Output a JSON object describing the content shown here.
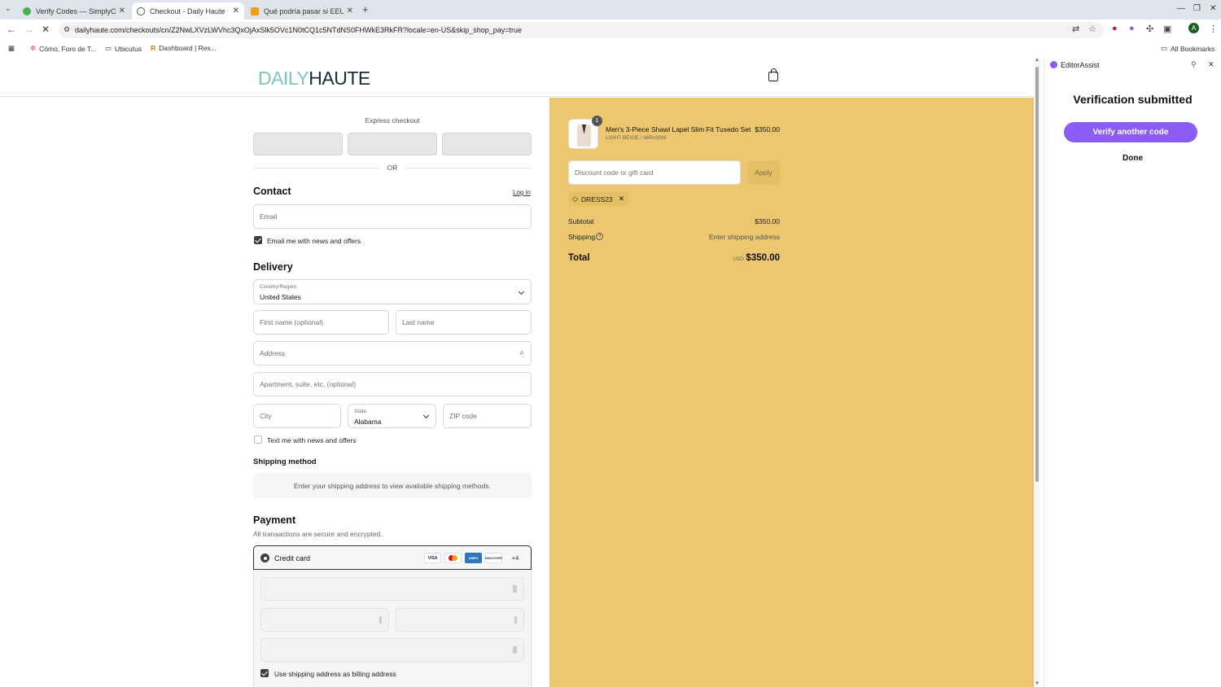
{
  "browser": {
    "tabs": [
      {
        "title": "Verify Codes — SimplyCodes",
        "active": false
      },
      {
        "title": "Checkout - Daily Haute",
        "active": true
      },
      {
        "title": "Qué podría pasar si EEUU a",
        "active": false
      }
    ],
    "url": "dailyhaute.com/checkouts/cn/Z2NwLXVzLWVhc3QxOjAxSlk5OVc1N0tCQ1c5NTdNS0FHWkE3RkFR?locale=en-US&skip_shop_pay=true",
    "bookmarks": [
      "Cómo, Foro de T...",
      "Ubicutus",
      "Dashboard | Res..."
    ],
    "all_bookmarks": "All Bookmarks",
    "profile_initial": "A"
  },
  "store": {
    "logo_part1": "DAILY",
    "logo_part2": "HAUTE"
  },
  "checkout": {
    "express_checkout": "Express checkout",
    "or": "OR",
    "contact": {
      "heading": "Contact",
      "login": "Log in",
      "email_placeholder": "Email",
      "newsletter": "Email me with news and offers",
      "newsletter_checked": true
    },
    "delivery": {
      "heading": "Delivery",
      "country_label": "Country/Region",
      "country_value": "United States",
      "first_name": "First name (optional)",
      "last_name": "Last name",
      "address": "Address",
      "apartment": "Apartment, suite, etc. (optional)",
      "city": "City",
      "state_label": "State",
      "state_value": "Alabama",
      "zip": "ZIP code",
      "sms": "Text me with news and offers",
      "sms_checked": false
    },
    "shipping_method": {
      "heading": "Shipping method",
      "note": "Enter your shipping address to view available shipping methods."
    },
    "payment": {
      "heading": "Payment",
      "sub": "All transactions are secure and encrypted.",
      "method": "Credit card",
      "cards": [
        "VISA",
        "MC",
        "AMEX",
        "DISCOVER"
      ],
      "more_cards": "+4",
      "billing_same": "Use shipping address as billing address",
      "billing_checked": true
    }
  },
  "summary": {
    "item": {
      "name": "Men's 3-Piece Shawl Lapel Slim Fit Tuxedo Set",
      "variant": "LIGHT BEIGE / 36Rx30W",
      "price": "$350.00",
      "quantity": "1"
    },
    "discount_placeholder": "Discount code or gift card",
    "apply": "Apply",
    "code": "DRESS23",
    "subtotal_label": "Subtotal",
    "subtotal": "$350.00",
    "shipping_label": "Shipping",
    "shipping_value": "Enter shipping address",
    "total_label": "Total",
    "currency": "USD",
    "total": "$350.00"
  },
  "extension": {
    "name": "EditorAssist",
    "title": "Verification submitted",
    "verify_btn": "Verify another code",
    "done": "Done",
    "accent": "#8b5cf6"
  }
}
